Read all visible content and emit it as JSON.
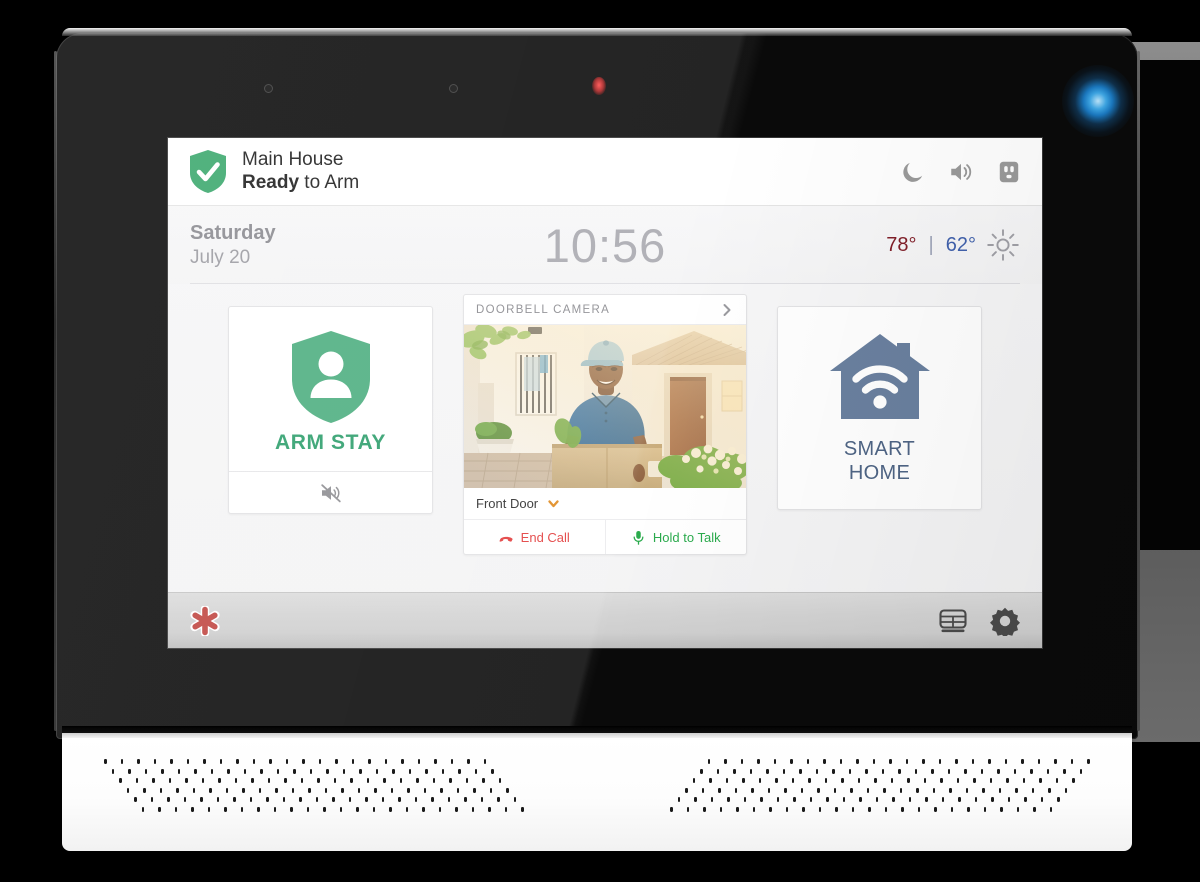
{
  "device": {
    "type": "security-touchscreen-panel",
    "bezel": {
      "sensors": [
        "sensor-dot-left",
        "sensor-dot-center",
        "led-red-indicator"
      ],
      "status_led": "blue-power-led"
    }
  },
  "screen": {
    "status_header": {
      "shield_icon": "shield-check-icon",
      "location": "Main House",
      "state_prefix": "Ready",
      "state_suffix": " to Arm",
      "icons": [
        {
          "name": "moon-icon",
          "label": "Night Mode"
        },
        {
          "name": "volume-icon",
          "label": "Volume"
        },
        {
          "name": "outlet-icon",
          "label": "Power Outlet"
        }
      ]
    },
    "datetime_bar": {
      "weekday": "Saturday",
      "date": "July 20",
      "clock": "10:56",
      "temp_high": "78°",
      "temp_separator": "|",
      "temp_low": "62°",
      "weather_icon": "sun-icon"
    },
    "cards": {
      "arm_stay": {
        "icon": "shield-person-icon",
        "label": "ARM STAY",
        "footer_icon": "speaker-muted-icon"
      },
      "doorbell_camera": {
        "title": "DOORBELL CAMERA",
        "expand_icon": "chevron-right-icon",
        "feed_alt": "Delivery person holding a cardboard box at the front door",
        "device_name": "Front Door",
        "device_chevron_icon": "chevron-down-icon",
        "actions": [
          {
            "name": "end-call",
            "label": "End Call",
            "icon": "phone-hangup-icon"
          },
          {
            "name": "hold-to-talk",
            "label": "Hold to Talk",
            "icon": "microphone-icon"
          }
        ]
      },
      "smart_home": {
        "icon": "house-wifi-icon",
        "label_line1": "SMART",
        "label_line2": "HOME"
      }
    },
    "bottom_bar": {
      "emergency_icon": "emergency-asterisk-icon",
      "right_icons": [
        {
          "name": "keypad-icon",
          "label": "Keypad"
        },
        {
          "name": "gear-icon",
          "label": "Settings"
        }
      ]
    }
  },
  "colors": {
    "shield_green": "#3aa76d",
    "arm_label_green": "#2c9e6b",
    "smart_home_blue": "#6a809f",
    "smart_home_text": "#4f6585",
    "end_call_red": "#e23b3b",
    "talk_green": "#2bab4d",
    "temp_high_red": "#7e1e28",
    "temp_low_blue": "#3f5fa8",
    "chevron_orange": "#e08a1e",
    "emergency_red": "#c0453f",
    "clock_gray": "#a9a9af",
    "led_blue": "#3fa9e8"
  }
}
